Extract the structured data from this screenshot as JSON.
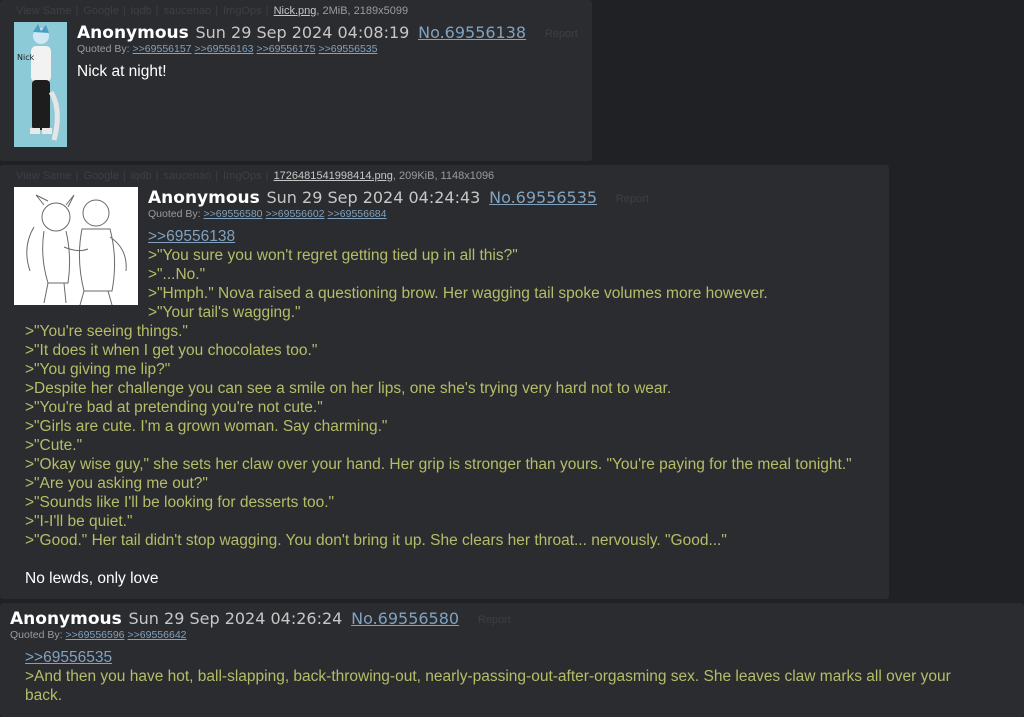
{
  "tools": [
    "View Same",
    "Google",
    "iqdb",
    "saucenao",
    "ImgOps"
  ],
  "posts": [
    {
      "file": {
        "name": "Nick.png",
        "meta": ", 2MiB, 2189x5099"
      },
      "name": "Anonymous",
      "date": "Sun 29 Sep 2024 04:08:19",
      "no": "No.69556138",
      "report": "Report",
      "quoted_by_label": "Quoted By:",
      "quoted_by": [
        ">>69556157",
        ">>69556163",
        ">>69556175",
        ">>69556535"
      ],
      "body": [
        "Nick at night!"
      ]
    },
    {
      "file": {
        "name": "1726481541998414.png",
        "meta": ", 209KiB, 1148x1096"
      },
      "name": "Anonymous",
      "date": "Sun 29 Sep 2024 04:24:43",
      "no": "No.69556535",
      "report": "Report",
      "quoted_by_label": "Quoted By:",
      "quoted_by": [
        ">>69556580",
        ">>69556602",
        ">>69556684"
      ],
      "quote_link": ">>69556138",
      "body": [
        ">\"You sure you won't regret getting tied up in all this?\"",
        ">\"...No.\"",
        ">\"Hmph.\" Nova raised a questioning brow. Her wagging tail spoke volumes more however.",
        ">\"Your tail's wagging.\"",
        ">\"You're seeing things.\"",
        ">\"It does it when I get you chocolates too.\"",
        ">\"You giving me lip?\"",
        ">Despite her challenge you can see a smile on her lips, one she's trying very hard not to wear.",
        ">\"You're bad at pretending you're not cute.\"",
        ">\"Girls are cute. I'm a grown woman. Say charming.\"",
        ">\"Cute.\"",
        ">\"Okay wise guy,\" she sets her claw over your hand. Her grip is stronger than yours. \"You're paying for the meal tonight.\"",
        ">\"Are you asking me out?\"",
        ">\"Sounds like I'll be looking for desserts too.\"",
        ">\"I-I'll be quiet.\"",
        ">\"Good.\" Her tail didn't stop wagging. You don't bring it up. She clears her throat... nervously. \"Good...\""
      ],
      "closing": "No lewds, only love"
    },
    {
      "name": "Anonymous",
      "date": "Sun 29 Sep 2024 04:26:24",
      "no": "No.69556580",
      "report": "Report",
      "quoted_by_label": "Quoted By:",
      "quoted_by": [
        ">>69556596",
        ">>69556642"
      ],
      "quote_link": ">>69556535",
      "body": [
        ">And then you have hot, ball-slapping, back-throwing-out, nearly-passing-out-after-orgasming sex. She leaves claw marks all over your",
        "back."
      ]
    }
  ]
}
